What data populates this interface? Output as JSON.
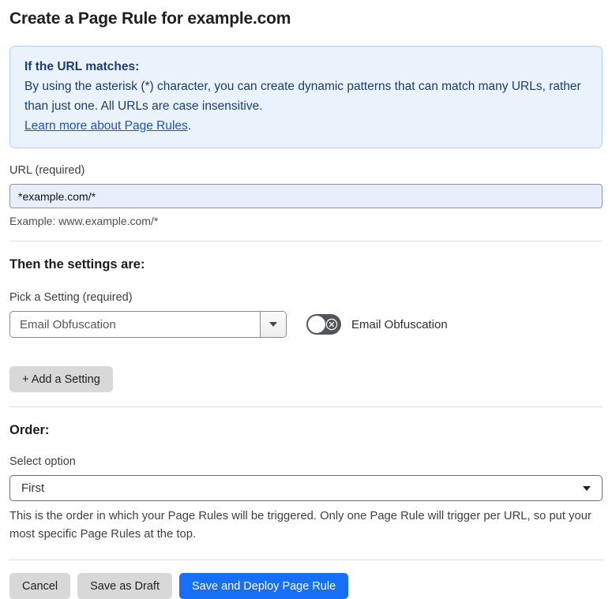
{
  "page": {
    "title": "Create a Page Rule for example.com"
  },
  "info_box": {
    "heading": "If the URL matches:",
    "body": "By using the asterisk (*) character, you can create dynamic patterns that can match many URLs, rather than just one. All URLs are case insensitive.",
    "link": "Learn more about Page Rules",
    "link_suffix": "."
  },
  "url_field": {
    "label": "URL (required)",
    "value": "*example.com/*",
    "helper": "Example: www.example.com/*"
  },
  "settings_section": {
    "heading": "Then the settings are:",
    "picker_label": "Pick a Setting (required)",
    "picker_value": "Email Obfuscation",
    "toggle_label": "Email Obfuscation",
    "toggle_state": "off",
    "add_button_label": "+ Add a Setting"
  },
  "order_section": {
    "heading": "Order:",
    "select_label": "Select option",
    "select_value": "First",
    "helper": "This is the order in which your Page Rules will be triggered. Only one Page Rule will trigger per URL, so put your most specific Page Rules at the top."
  },
  "footer": {
    "cancel_label": "Cancel",
    "save_draft_label": "Save as Draft",
    "save_deploy_label": "Save and Deploy Page Rule"
  },
  "colors": {
    "primary_blue": "#166ff4",
    "info_bg": "#eaf3fc",
    "info_border": "#b4d0e8",
    "info_text": "#1e3c6e",
    "link_blue": "#1d53c0",
    "input_bg": "#e8eefb",
    "toggle_off": "#515559",
    "gray_button": "#d8d8d8"
  }
}
